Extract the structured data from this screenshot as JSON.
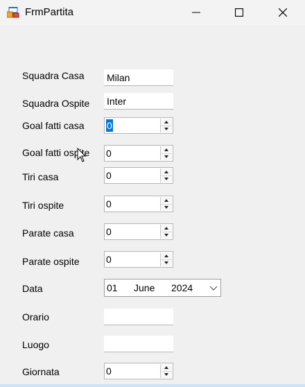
{
  "window": {
    "title": "FrmPartita",
    "icons": [
      "app-form-icon",
      "minimize-icon",
      "maximize-icon",
      "close-icon"
    ]
  },
  "form": {
    "squadra_casa": {
      "label": "Squadra Casa",
      "value": "Milan"
    },
    "squadra_ospite": {
      "label": "Squadra Ospite",
      "value": "Inter"
    },
    "goal_casa": {
      "label": "Goal fatti casa",
      "value": "0"
    },
    "goal_ospite": {
      "label": "Goal fatti ospite",
      "value": "0"
    },
    "tiri_casa": {
      "label": "Tiri casa",
      "value": "0"
    },
    "tiri_ospite": {
      "label": "Tiri ospite",
      "value": "0"
    },
    "parate_casa": {
      "label": "Parate casa",
      "value": "0"
    },
    "parate_ospite": {
      "label": "Parate ospite",
      "value": "0"
    },
    "data": {
      "label": "Data",
      "day": "01",
      "month": "June",
      "year": "2024"
    },
    "orario": {
      "label": "Orario",
      "value": ""
    },
    "luogo": {
      "label": "Luogo",
      "value": ""
    },
    "giornata": {
      "label": "Giornata",
      "value": "0"
    }
  },
  "colors": {
    "selection": "#0078d7",
    "form_background": "#f0f0f0"
  }
}
